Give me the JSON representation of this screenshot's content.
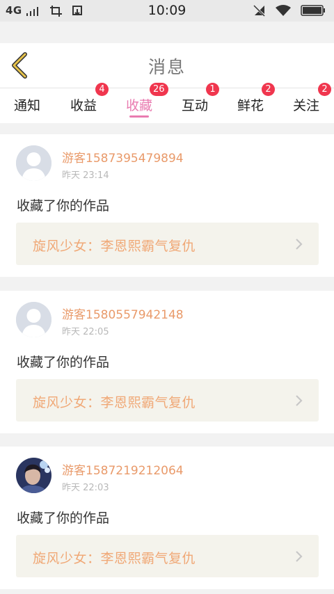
{
  "status_bar": {
    "network": "4G",
    "time": "10:09"
  },
  "header": {
    "title": "消息"
  },
  "tabs": [
    {
      "label": "通知",
      "badge": ""
    },
    {
      "label": "收益",
      "badge": "4"
    },
    {
      "label": "收藏",
      "badge": "26",
      "active": true
    },
    {
      "label": "互动",
      "badge": "1"
    },
    {
      "label": "鲜花",
      "badge": "2"
    },
    {
      "label": "关注",
      "badge": "2"
    }
  ],
  "items": [
    {
      "user": "游客1587395479894",
      "time": "昨天 23:14",
      "action": "收藏了你的作品",
      "work": "旋风少女：李恩熙霸气复仇",
      "avatar": "default-avatar"
    },
    {
      "user": "游客1580557942148",
      "time": "昨天 22:05",
      "action": "收藏了你的作品",
      "work": "旋风少女：李恩熙霸气复仇",
      "avatar": "default-avatar"
    },
    {
      "user": "游客1587219212064",
      "time": "昨天 22:03",
      "action": "收藏了你的作品",
      "work": "旋风少女：李恩熙霸气复仇",
      "avatar": "photo-avatar"
    }
  ],
  "colors": {
    "accent": "#e97bb0",
    "username": "#e99a6a",
    "work_title": "#f0a876",
    "badge": "#f0364e",
    "back_arrow": "#e7c34a"
  }
}
